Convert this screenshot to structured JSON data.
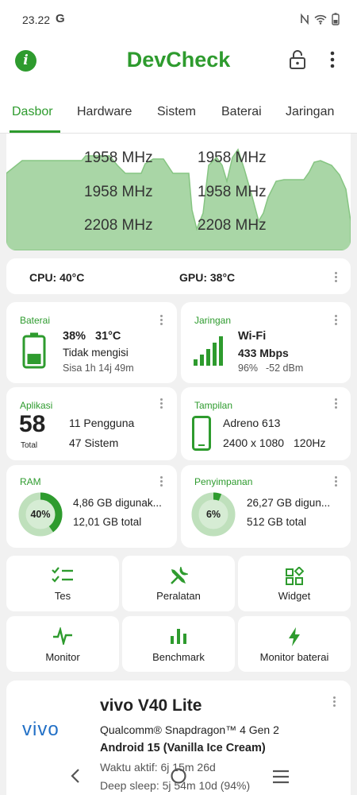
{
  "status_bar": {
    "time": "23.22",
    "g_mark": "G"
  },
  "app_bar": {
    "title": "DevCheck",
    "info_icon": "i"
  },
  "tabs": [
    {
      "label": "Dasbor",
      "active": true
    },
    {
      "label": "Hardware"
    },
    {
      "label": "Sistem"
    },
    {
      "label": "Baterai"
    },
    {
      "label": "Jaringan"
    }
  ],
  "cpu_freqs": [
    "1958 MHz",
    "1958 MHz",
    "1958 MHz",
    "1958 MHz",
    "2208 MHz",
    "2208 MHz"
  ],
  "temps": {
    "cpu": "CPU: 40°C",
    "gpu": "GPU: 38°C"
  },
  "battery": {
    "title": "Baterai",
    "level": "38%",
    "temp": "31°C",
    "status": "Tidak mengisi",
    "remaining": "Sisa 1h 14j 49m",
    "level_fraction": 0.38
  },
  "network": {
    "title": "Jaringan",
    "type": "Wi-Fi",
    "speed": "433 Mbps",
    "quality": "96%",
    "signal": "-52 dBm"
  },
  "apps": {
    "title": "Aplikasi",
    "count": "58",
    "count_label": "Total",
    "users": "11 Pengguna",
    "system": "47 Sistem"
  },
  "display": {
    "title": "Tampilan",
    "gpu": "Adreno 613",
    "resolution": "2400 x 1080",
    "refresh": "120Hz"
  },
  "ram": {
    "title": "RAM",
    "percent_label": "40%",
    "used": "4,86 GB digunak...",
    "total": "12,01 GB total",
    "fraction": 0.4
  },
  "storage": {
    "title": "Penyimpanan",
    "percent_label": "6%",
    "used": "26,27 GB digun...",
    "total": "512 GB total",
    "fraction": 0.06
  },
  "actions": [
    {
      "label": "Tes",
      "icon": "checklist-icon"
    },
    {
      "label": "Peralatan",
      "icon": "tools-icon"
    },
    {
      "label": "Widget",
      "icon": "widgets-icon"
    },
    {
      "label": "Monitor",
      "icon": "pulse-icon"
    },
    {
      "label": "Benchmark",
      "icon": "bar-chart-icon"
    },
    {
      "label": "Monitor baterai",
      "icon": "bolt-icon"
    }
  ],
  "device": {
    "brand_logo": "vivo",
    "model": "vivo V40 Lite",
    "soc": "Qualcomm® Snapdragon™ 4 Gen 2",
    "android": "Android 15 (Vanilla Ice Cream)",
    "uptime": "Waktu aktif: 6j 15m 26d",
    "deep_sleep": "Deep sleep: 5j 54m 10d (94%)"
  },
  "colors": {
    "accent": "#2e9b2e",
    "graph_fill": "#a9d6a6",
    "graph_stroke": "#7fc07a",
    "vivo_blue": "#2270c6"
  }
}
